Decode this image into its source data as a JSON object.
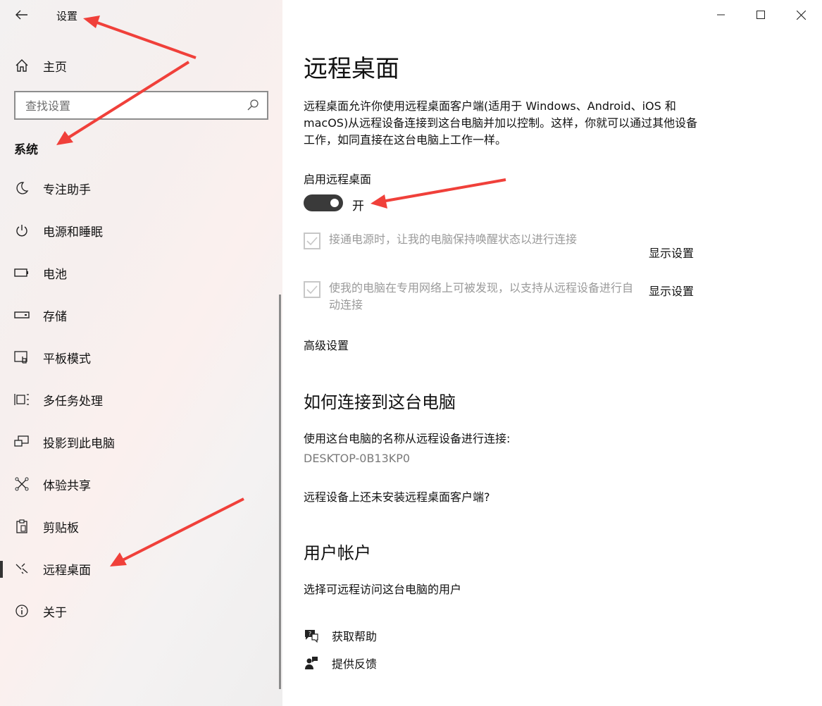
{
  "window": {
    "title": "设置",
    "controls": [
      "minimize",
      "maximize",
      "close"
    ]
  },
  "sidebar": {
    "home_label": "主页",
    "search_placeholder": "查找设置",
    "section_title": "系统",
    "items": [
      {
        "label": "专注助手",
        "icon": "moon-icon",
        "selected": false
      },
      {
        "label": "电源和睡眠",
        "icon": "power-icon",
        "selected": false
      },
      {
        "label": "电池",
        "icon": "battery-icon",
        "selected": false
      },
      {
        "label": "存储",
        "icon": "storage-icon",
        "selected": false
      },
      {
        "label": "平板模式",
        "icon": "tablet-mode-icon",
        "selected": false
      },
      {
        "label": "多任务处理",
        "icon": "multitasking-icon",
        "selected": false
      },
      {
        "label": "投影到此电脑",
        "icon": "projecting-icon",
        "selected": false
      },
      {
        "label": "体验共享",
        "icon": "shared-experiences-icon",
        "selected": false
      },
      {
        "label": "剪贴板",
        "icon": "clipboard-icon",
        "selected": false
      },
      {
        "label": "远程桌面",
        "icon": "remote-desktop-icon",
        "selected": true
      },
      {
        "label": "关于",
        "icon": "info-icon",
        "selected": false
      }
    ]
  },
  "main": {
    "title": "远程桌面",
    "description": "远程桌面允许你使用远程桌面客户端(适用于 Windows、Android、iOS 和 macOS)从远程设备连接到这台电脑并加以控制。这样，你就可以通过其他设备工作，如同直接在这台电脑上工作一样。",
    "enable_label": "启用远程桌面",
    "toggle_state": "开",
    "toggle_on": true,
    "checkbox1": {
      "label": "接通电源时，让我的电脑保持唤醒状态以进行连接",
      "checked": true,
      "link": "显示设置"
    },
    "checkbox2": {
      "label": "使我的电脑在专用网络上可被发现，以支持从远程设备进行自动连接",
      "checked": true,
      "link": "显示设置"
    },
    "advanced_link": "高级设置",
    "how_to_title": "如何连接到这台电脑",
    "use_name_text": "使用这台电脑的名称从远程设备进行连接:",
    "pc_name": "DESKTOP-0B13KP0",
    "no_client_link": "远程设备上还未安装远程桌面客户端?",
    "accounts_title": "用户帐户",
    "select_users_link": "选择可远程访问这台电脑的用户",
    "get_help": "获取帮助",
    "give_feedback": "提供反馈"
  },
  "colors": {
    "accent_dark": "#3a3a3a",
    "annotation_arrow": "#f0403a",
    "disabled_text": "#9a9a9a"
  }
}
